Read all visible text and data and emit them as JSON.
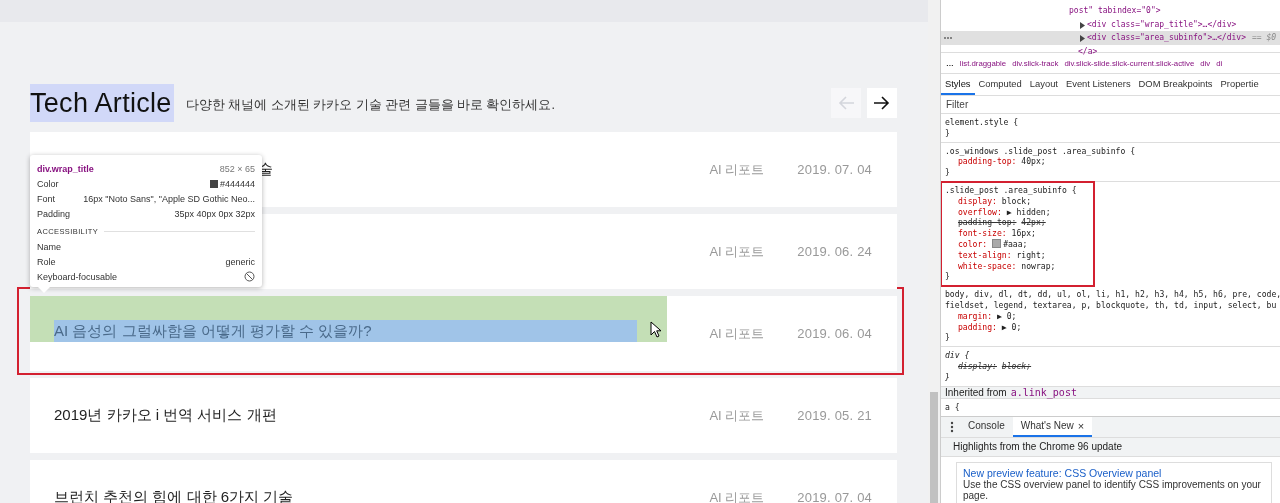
{
  "section": {
    "title": "Tech Article",
    "subtitle": "다양한 채널에 소개된 카카오 기술 관련 글들을 바로 확인하세요.",
    "nav": [
      {
        "kind": "prev",
        "disabled": true
      },
      {
        "kind": "next",
        "disabled": false
      }
    ]
  },
  "articles": [
    {
      "title": "술",
      "category": "AI 리포트",
      "date": "2019. 07. 04",
      "highlighted": false
    },
    {
      "category": "AI 리포트",
      "date": "2019. 06. 24",
      "highlighted": false
    },
    {
      "title": "AI 음성의 그럴싸함을 어떻게 평가할 수 있을까?",
      "category": "AI 리포트",
      "date": "2019. 06. 04",
      "highlighted": true
    },
    {
      "title": "2019년 카카오 i 번역 서비스 개편",
      "category": "AI 리포트",
      "date": "2019. 05. 21",
      "highlighted": false
    },
    {
      "title": "브런치 추천의 힘에 대한 6가지 기술",
      "category": "AI 리포트",
      "date": "2019. 07. 04",
      "highlighted": false
    }
  ],
  "inspect_tooltip": {
    "selector": "div.wrap_title",
    "size": "852 × 65",
    "rows": [
      {
        "label": "Color",
        "value": "#444444",
        "kind": "color"
      },
      {
        "label": "Font",
        "value": "16px \"Noto Sans\", \"Apple SD Gothic Neo..."
      },
      {
        "label": "Padding",
        "value": "35px 40px 0px 32px"
      }
    ],
    "accessibility_heading": "ACCESSIBILITY",
    "name_label": "Name",
    "role_label": "Role",
    "role": "generic",
    "focusable_label": "Keyboard-focusable",
    "keyboard_focusable": false
  },
  "devtools": {
    "dom_lines": [
      {
        "text": "post\" tabindex=\"0\">",
        "kind": "attr",
        "selected": false
      },
      {
        "text": "<div class=\"wrap_title\">…</div>",
        "kind": "collapsed",
        "selected": false
      },
      {
        "text": "<div class=\"area_subinfo\">…</div>",
        "kind": "collapsed",
        "selected": true,
        "note": "== $0"
      },
      {
        "text": "</a>",
        "kind": "close",
        "selected": false
      }
    ],
    "breadcrumbs": [
      {
        "text": "…",
        "kind": "more"
      },
      {
        "text": "list.draggable",
        "kind": "node"
      },
      {
        "text": "div.slick-track",
        "kind": "node"
      },
      {
        "text": "div.slick-slide.slick-current.slick-active",
        "kind": "node"
      },
      {
        "text": "div",
        "kind": "node"
      },
      {
        "text": "di",
        "kind": "node"
      }
    ],
    "tabs": [
      {
        "label": "Styles",
        "selected": true
      },
      {
        "label": "Computed",
        "selected": false
      },
      {
        "label": "Layout",
        "selected": false
      },
      {
        "label": "Event Listeners",
        "selected": false
      },
      {
        "label": "DOM Breakpoints",
        "selected": false
      },
      {
        "label": "Propertie",
        "selected": false
      }
    ],
    "filter_placeholder": "Filter",
    "rules": [
      {
        "selector": [
          "element.style {"
        ],
        "close": "}",
        "outlined": false,
        "user_agent": false
      },
      {
        "selector": [
          ".os_windows .slide_post .area_subinfo {"
        ],
        "props": [
          {
            "name": "padding-top:",
            "value": "40px;",
            "overridden": false
          }
        ],
        "close": "}",
        "outlined": false,
        "user_agent": false
      },
      {
        "selector": [
          ".slide_post .area_subinfo {"
        ],
        "props": [
          {
            "name": "display:",
            "value": "block;",
            "overridden": false
          },
          {
            "name": "overflow:",
            "value": "▶ hidden;",
            "overridden": false
          },
          {
            "name": "padding-top:",
            "value": "42px;",
            "overridden": true
          },
          {
            "name": "font-size:",
            "value": "16px;",
            "overridden": false
          },
          {
            "name": "color:",
            "value": "#aaa;",
            "overridden": false,
            "kind": "color"
          },
          {
            "name": "text-align:",
            "value": "right;",
            "overridden": false
          },
          {
            "name": "white-space:",
            "value": "nowrap;",
            "overridden": false
          }
        ],
        "close": "}",
        "outlined": true,
        "user_agent": false
      },
      {
        "selector": [
          "body, div, dl, dt, dd, ul, ol, li, h1, h2, h3, h4, h5, h6, pre, code,",
          "fieldset, legend, textarea, p, blockquote, th, td, input, select, bu"
        ],
        "props": [
          {
            "name": "margin:",
            "value": "▶ 0;",
            "overridden": false
          },
          {
            "name": "padding:",
            "value": "▶ 0;",
            "overridden": false
          }
        ],
        "close": "}",
        "outlined": false,
        "user_agent": false
      },
      {
        "selector": [
          "div {"
        ],
        "props": [
          {
            "name": "display:",
            "value": "block;",
            "overridden": true
          }
        ],
        "close": "}",
        "outlined": false,
        "user_agent": true
      }
    ],
    "inherited_label": "Inherited from",
    "inherited_from": "a.link_post",
    "next_rule": "a {",
    "drawer_tabs": [
      {
        "label": "Console",
        "selected": false,
        "closable": false
      },
      {
        "label": "What's New",
        "selected": true,
        "closable": true
      }
    ],
    "close_glyph": "×",
    "highlights": "Highlights from the Chrome 96 update",
    "card": {
      "title": "New preview feature: CSS Overview panel",
      "text": "Use the CSS overview panel to identify CSS improvements on your page."
    }
  }
}
